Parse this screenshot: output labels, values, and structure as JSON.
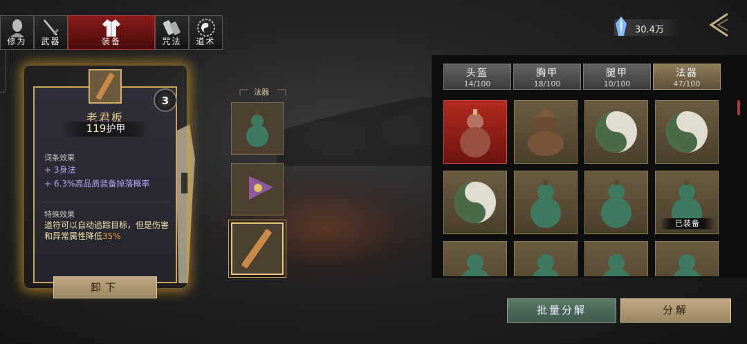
{
  "tabs": [
    {
      "label": "修为",
      "icon": "cultivator-head-icon"
    },
    {
      "label": "武器",
      "icon": "sword-icon"
    },
    {
      "label": "装备",
      "icon": "robe-icon"
    },
    {
      "label": "咒法",
      "icon": "scroll-icon"
    },
    {
      "label": "道术",
      "icon": "taiji-icon"
    }
  ],
  "active_tab": "装备",
  "currency": {
    "value": "30.4万",
    "icon": "spirit-crystal-icon"
  },
  "detail": {
    "item_name": "老君板",
    "armor_value": "119",
    "armor_label": "护甲",
    "level_badge": "3",
    "affix_title": "词条效果",
    "affixes": [
      {
        "prefix": "+ 3",
        "text": "身法"
      },
      {
        "prefix": "+ 6.3%",
        "text": "高品质装备掉落概率"
      }
    ],
    "special_title": "特殊效果",
    "special_text_a": "道符可以自动追踪目标，但是伤害和异常属性降低",
    "special_highlight": "35%",
    "unequip_label": "卸下"
  },
  "slots": {
    "header": "法器",
    "items": [
      {
        "name": "gourd-item"
      },
      {
        "name": "pennant-item"
      },
      {
        "name": "talisman-board-item",
        "selected": true
      }
    ]
  },
  "categories": [
    {
      "name": "头盔",
      "count": "14/100"
    },
    {
      "name": "胸甲",
      "count": "18/100"
    },
    {
      "name": "腿甲",
      "count": "10/100"
    },
    {
      "name": "法器",
      "count": "47/100",
      "active": true
    }
  ],
  "inventory": [
    {
      "item": "red-gourd",
      "rarity": "red"
    },
    {
      "item": "bronze-censer"
    },
    {
      "item": "taiji-disc"
    },
    {
      "item": "taiji-disc"
    },
    {
      "item": "taiji-disc"
    },
    {
      "item": "green-gourd"
    },
    {
      "item": "green-gourd"
    },
    {
      "item": "green-gourd",
      "equipped": true
    },
    {
      "item": "green-gourd"
    },
    {
      "item": "green-gourd"
    },
    {
      "item": "green-gourd"
    },
    {
      "item": "green-gourd"
    }
  ],
  "equipped_label": "已装备",
  "actions": {
    "batch_decompose": "批量分解",
    "decompose": "分解"
  },
  "colors": {
    "accent_red": "#8a1a1a",
    "gold_border": "#c9a55a",
    "affix_purple": "#b6a4f0",
    "highlight_orange": "#f0a040"
  }
}
